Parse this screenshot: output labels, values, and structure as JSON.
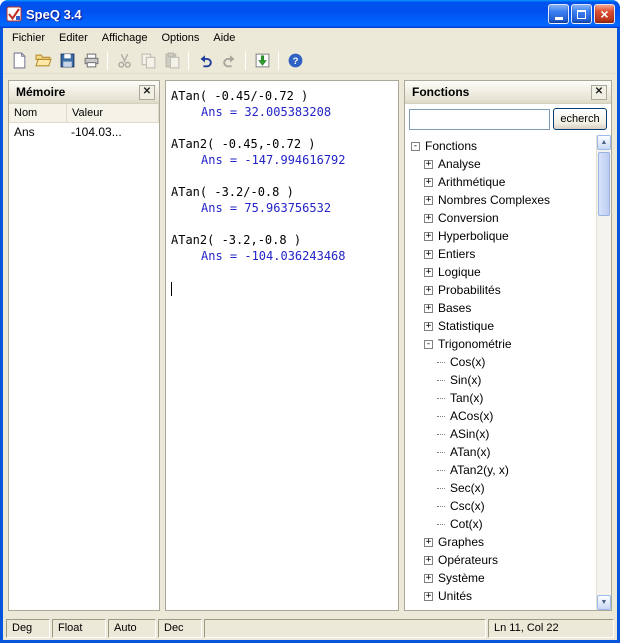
{
  "window": {
    "title": "SpeQ 3.4"
  },
  "menu": {
    "items": [
      "Fichier",
      "Editer",
      "Affichage",
      "Options",
      "Aide"
    ]
  },
  "toolbar": {
    "buttons": [
      {
        "icon": "new-icon",
        "enabled": true
      },
      {
        "icon": "open-icon",
        "enabled": true
      },
      {
        "icon": "save-icon",
        "enabled": true
      },
      {
        "icon": "print-icon",
        "enabled": true
      },
      {
        "sep": true
      },
      {
        "icon": "cut-icon",
        "enabled": false
      },
      {
        "icon": "copy-icon",
        "enabled": false
      },
      {
        "icon": "paste-icon",
        "enabled": false
      },
      {
        "sep": true
      },
      {
        "icon": "undo-icon",
        "enabled": true
      },
      {
        "icon": "redo-icon",
        "enabled": false
      },
      {
        "sep": true
      },
      {
        "icon": "insert-icon",
        "enabled": true
      },
      {
        "sep": true
      },
      {
        "icon": "help-icon",
        "enabled": true
      }
    ]
  },
  "memory_panel": {
    "title": "Mémoire",
    "columns": [
      "Nom",
      "Valeur"
    ],
    "rows": [
      {
        "nom": "Ans",
        "valeur": "-104.03..."
      }
    ]
  },
  "worksheet": {
    "lines": [
      {
        "type": "expr",
        "text": "ATan( -0.45/-0.72 )"
      },
      {
        "type": "ans",
        "text": "Ans = 32.005383208"
      },
      {
        "type": "blank",
        "text": ""
      },
      {
        "type": "expr",
        "text": "ATan2( -0.45,-0.72 )"
      },
      {
        "type": "ans",
        "text": "Ans = -147.994616792"
      },
      {
        "type": "blank",
        "text": ""
      },
      {
        "type": "expr",
        "text": "ATan( -3.2/-0.8 )"
      },
      {
        "type": "ans",
        "text": "Ans = 75.963756532"
      },
      {
        "type": "blank",
        "text": ""
      },
      {
        "type": "expr",
        "text": "ATan2( -3.2,-0.8 )"
      },
      {
        "type": "ans",
        "text": "Ans = -104.036243468"
      },
      {
        "type": "blank",
        "text": ""
      },
      {
        "type": "caret",
        "text": ""
      }
    ]
  },
  "functions_panel": {
    "title": "Fonctions",
    "search": {
      "value": "",
      "button_label": "echerch"
    },
    "tree": [
      {
        "label": "Fonctions",
        "expandable": true,
        "expanded": true,
        "children": [
          {
            "label": "Analyse",
            "expandable": true,
            "expanded": false
          },
          {
            "label": "Arithmétique",
            "expandable": true,
            "expanded": false
          },
          {
            "label": "Nombres Complexes",
            "expandable": true,
            "expanded": false
          },
          {
            "label": "Conversion",
            "expandable": true,
            "expanded": false
          },
          {
            "label": "Hyperbolique",
            "expandable": true,
            "expanded": false
          },
          {
            "label": "Entiers",
            "expandable": true,
            "expanded": false
          },
          {
            "label": "Logique",
            "expandable": true,
            "expanded": false
          },
          {
            "label": "Probabilités",
            "expandable": true,
            "expanded": false
          },
          {
            "label": "Bases",
            "expandable": true,
            "expanded": false
          },
          {
            "label": "Statistique",
            "expandable": true,
            "expanded": false
          },
          {
            "label": "Trigonométrie",
            "expandable": true,
            "expanded": true,
            "children": [
              {
                "label": "Cos(x)"
              },
              {
                "label": "Sin(x)"
              },
              {
                "label": "Tan(x)"
              },
              {
                "label": "ACos(x)"
              },
              {
                "label": "ASin(x)"
              },
              {
                "label": "ATan(x)"
              },
              {
                "label": "ATan2(y, x)"
              },
              {
                "label": "Sec(x)"
              },
              {
                "label": "Csc(x)"
              },
              {
                "label": "Cot(x)"
              }
            ]
          },
          {
            "label": "Graphes",
            "expandable": true,
            "expanded": false
          },
          {
            "label": "Opérateurs",
            "expandable": true,
            "expanded": false
          },
          {
            "label": "Système",
            "expandable": true,
            "expanded": false
          },
          {
            "label": "Unités",
            "expandable": true,
            "expanded": false
          }
        ]
      }
    ]
  },
  "statusbar": {
    "cells": [
      "Deg",
      "Float",
      "Auto",
      "Dec",
      "",
      "Ln 11, Col 22"
    ]
  },
  "colors": {
    "titlebar_blue": "#0054E3",
    "answer_text": "#2424C8",
    "window_frame": "#0855DD"
  }
}
